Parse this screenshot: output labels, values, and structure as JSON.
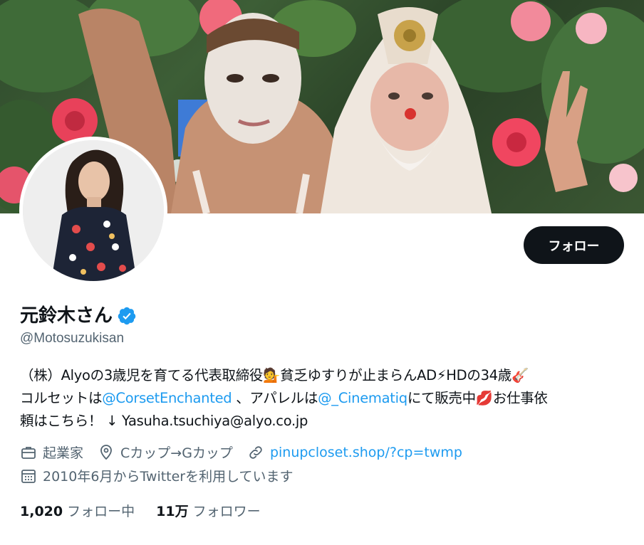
{
  "profile": {
    "display_name": "元鈴木さん",
    "handle": "@Motosuzukisan",
    "follow_label": "フォロー",
    "bio": {
      "line1_text": "（株）Alyoの3歳児を育てる代表取締役",
      "line1_emoji1": "💁",
      "line1_text2": "貧乏ゆすりが止まらんAD",
      "line1_emoji2": "⚡",
      "line1_text3": "HDの34歳",
      "line1_emoji3": "🎸",
      "line2_text1": "コルセットは",
      "line2_link1": "@CorsetEnchanted",
      "line2_text2": " 、アパレルは",
      "line2_link2": "@_Cinematiq",
      "line2_text3": "にて販売中",
      "line2_emoji": "💋",
      "line2_text4": "お仕事依",
      "line3_text": "頼はこちら！ ↓ Yasuha.tsuchiya@alyo.co.jp"
    },
    "meta": {
      "profession": "起業家",
      "location": "Cカップ→Gカップ",
      "website": "pinupcloset.shop/?cp=twmp",
      "joined": "2010年6月からTwitterを利用しています"
    },
    "stats": {
      "following_count": "1,020",
      "following_label": "フォロー中",
      "followers_count": "11万",
      "followers_label": "フォロワー"
    }
  },
  "icons": {
    "verified": "verified-badge-icon",
    "profession": "briefcase-icon",
    "location": "location-pin-icon",
    "website": "link-icon",
    "joined": "calendar-icon"
  },
  "colors": {
    "accent": "#1d9bf0",
    "text_primary": "#0f1419",
    "text_secondary": "#536471",
    "button_bg": "#0f1419"
  }
}
